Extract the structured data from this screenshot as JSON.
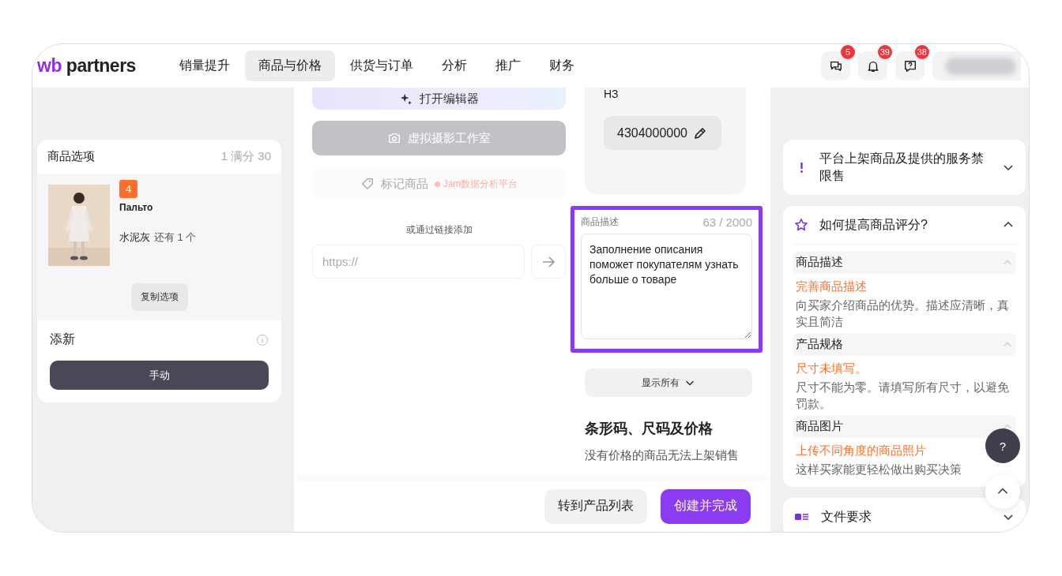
{
  "header": {
    "logo_prefix": "wb",
    "logo_suffix": "partners",
    "nav": [
      {
        "label": "销量提升",
        "selected": false
      },
      {
        "label": "商品与价格",
        "selected": true
      },
      {
        "label": "供货与订单",
        "selected": false
      },
      {
        "label": "分析",
        "selected": false
      },
      {
        "label": "推广",
        "selected": false
      },
      {
        "label": "财务",
        "selected": false
      }
    ],
    "icons": [
      {
        "kind": "chat",
        "badge": "5"
      },
      {
        "kind": "bell",
        "badge": "39"
      },
      {
        "kind": "help",
        "badge": "38"
      }
    ]
  },
  "variants_card": {
    "title": "商品选项",
    "count": "1 满分 30",
    "variant": {
      "badge": "4",
      "name": "Пальто",
      "shade": "水泥灰",
      "stock": "还有 1 个"
    },
    "copy_button": "复制选项",
    "add_title": "添新",
    "manual_button": "手动"
  },
  "media": {
    "editor_button": "打开编辑器",
    "studio_button": "虚拟摄影工作室",
    "tag_button": "标记商品",
    "tag_partner": "Jam数据分析平台",
    "link_label": "或通过链接添加",
    "link_placeholder": "https://"
  },
  "code_card": {
    "label": "НЗ",
    "code": "4304000000"
  },
  "description": {
    "label": "商品描述",
    "counter": "63 / 2000",
    "value": "Заполнение описания поможет покупателям узнать больше о товаре",
    "focused": true
  },
  "show_all_button": "显示所有",
  "pricing": {
    "title": "条形码、尺码及价格",
    "text": "没有价格的商品无法上架销售"
  },
  "actions": [
    {
      "label": "转到产品列表",
      "kind": "secondary"
    },
    {
      "label": "创建并完成",
      "kind": "primary"
    }
  ],
  "tips": [
    {
      "kind": "warning",
      "title": "平台上架商品及提供的服务禁限售",
      "expanded": false
    },
    {
      "kind": "rating",
      "title": "如何提高商品评分?",
      "expanded": true,
      "sections": [
        {
          "title": "商品描述",
          "headline": "完善商品描述",
          "text": "向买家介绍商品的优势。描述应清晰，真实且简洁"
        },
        {
          "title": "产品规格",
          "headline": "尺寸未填写。",
          "text": "尺寸不能为零。请填写所有尺寸，以避免罚款。"
        },
        {
          "title": "商品图片",
          "headline": "上传不同角度的商品照片",
          "text": "这样买家能更轻松做出购买决策"
        }
      ]
    },
    {
      "kind": "files",
      "title": "文件要求",
      "expanded": false
    }
  ],
  "help_button": "?"
}
